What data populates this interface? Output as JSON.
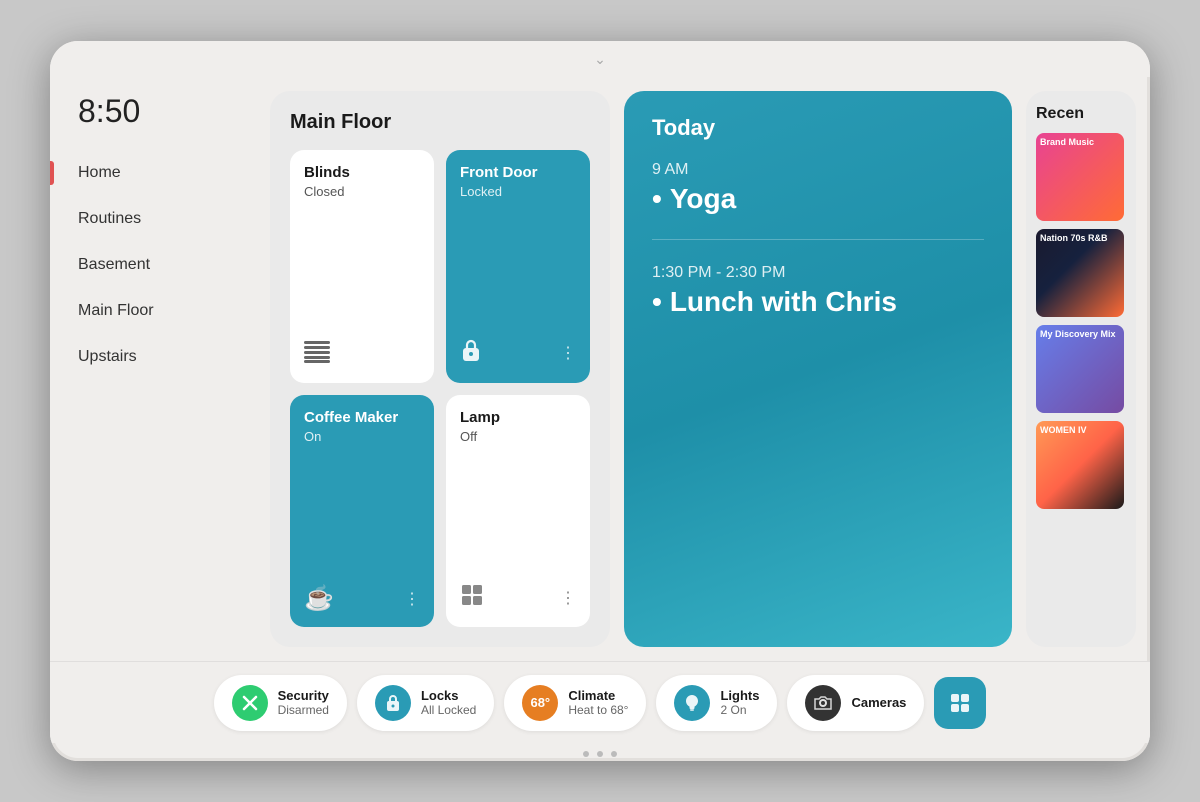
{
  "device": {
    "time": "8:50"
  },
  "sidebar": {
    "nav_items": [
      {
        "label": "Home",
        "active": true
      },
      {
        "label": "Routines",
        "active": false
      },
      {
        "label": "Basement",
        "active": false
      },
      {
        "label": "Main Floor",
        "active": false
      },
      {
        "label": "Upstairs",
        "active": false
      }
    ]
  },
  "main_floor": {
    "title": "Main Floor",
    "devices": [
      {
        "name": "Blinds",
        "status": "Closed",
        "theme": "light",
        "icon": "blinds"
      },
      {
        "name": "Front Door",
        "status": "Locked",
        "theme": "teal",
        "icon": "lock"
      },
      {
        "name": "Coffee Maker",
        "status": "On",
        "theme": "teal",
        "icon": "coffee"
      },
      {
        "name": "Lamp",
        "status": "Off",
        "theme": "light",
        "icon": "lamp"
      }
    ]
  },
  "today": {
    "label": "Today",
    "events": [
      {
        "time": "9 AM",
        "title": "Yoga"
      },
      {
        "time": "1:30 PM - 2:30 PM",
        "title": "Lunch with Chris"
      }
    ]
  },
  "recent": {
    "title": "Recen",
    "items": [
      {
        "label": "Brand Music",
        "color1": "#e84393",
        "color2": "#ff6b35"
      },
      {
        "label": "Nation 70s R&B",
        "color1": "#1a1a2e",
        "color2": "#ff6b35"
      },
      {
        "label": "My Discovery Mix",
        "color1": "#667eea",
        "color2": "#764ba2"
      },
      {
        "label": "WOMEN IV",
        "color1": "#ff9a56",
        "color2": "#1a1a1a"
      }
    ]
  },
  "bottom_bar": {
    "pills": [
      {
        "name": "Security",
        "value": "Disarmed",
        "icon_type": "green",
        "icon": "✕"
      },
      {
        "name": "Locks",
        "value": "All Locked",
        "icon_type": "teal",
        "icon": "🔒"
      },
      {
        "name": "Climate",
        "value": "Heat to 68°",
        "icon_type": "orange",
        "icon": "68°"
      },
      {
        "name": "Lights",
        "value": "2 On",
        "icon_type": "teal2",
        "icon": "💡"
      },
      {
        "name": "Cameras",
        "value": "",
        "icon_type": "dark",
        "icon": "📷"
      }
    ],
    "icon_only": "▦",
    "dots": [
      "",
      "",
      ""
    ]
  }
}
